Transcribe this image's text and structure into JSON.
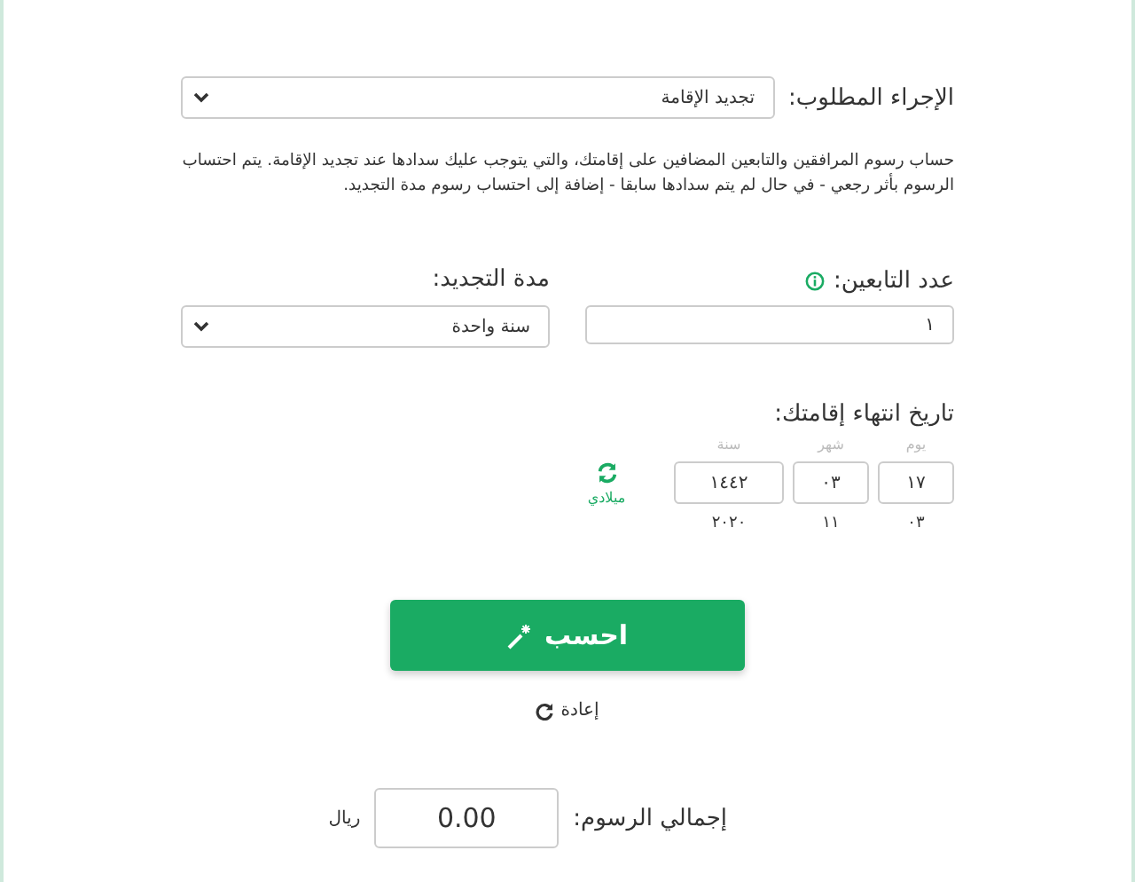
{
  "procedure": {
    "label": "الإجراء المطلوب:",
    "value": "تجديد الإقامة"
  },
  "description": "حساب رسوم المرافقين والتابعين المضافين على إقامتك، والتي يتوجب عليك سدادها عند تجديد الإقامة. يتم احتساب الرسوم بأثر رجعي - في حال لم يتم سدادها سابقا - إضافة إلى احتساب رسوم مدة التجديد.",
  "dependents": {
    "label": "عدد التابعين:",
    "value": "١"
  },
  "duration": {
    "label": "مدة التجديد:",
    "value": "سنة واحدة"
  },
  "expiry": {
    "label": "تاريخ انتهاء إقامتك:",
    "fields": [
      {
        "label": "يوم",
        "value": "١٧",
        "converted": "٠٣"
      },
      {
        "label": "شهر",
        "value": "٠٣",
        "converted": "١١"
      },
      {
        "label": "سنة",
        "value": "١٤٤٢",
        "converted": "٢٠٢٠"
      }
    ],
    "toggle": "ميلادي"
  },
  "calculate_button": "احسب",
  "reset_link": "إعادة",
  "total": {
    "label": "إجمالي الرسوم:",
    "value": "0.00",
    "unit": "ريال"
  }
}
